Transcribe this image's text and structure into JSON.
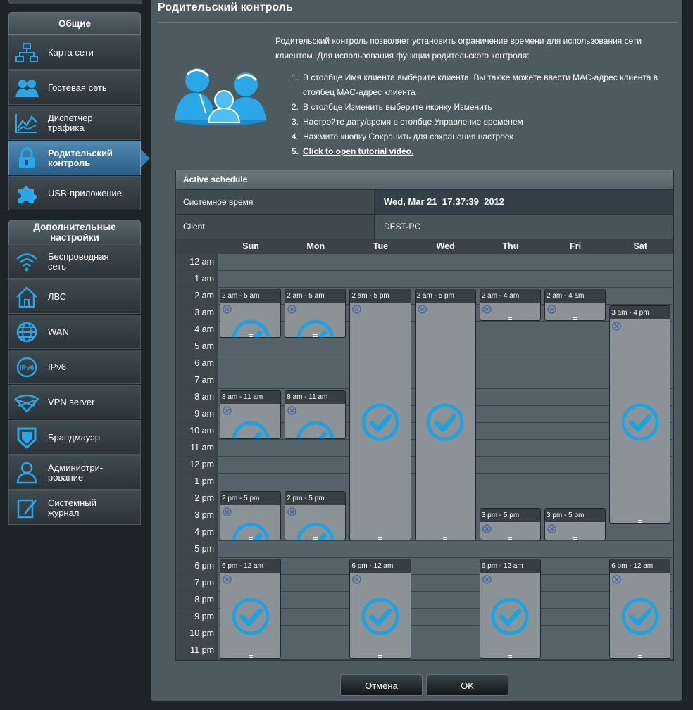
{
  "sidebar": {
    "general_title": "Общие",
    "general_items": [
      {
        "label": "Карта сети",
        "icon": "network-map-icon"
      },
      {
        "label": "Гостевая сеть",
        "icon": "guest-network-icon"
      },
      {
        "label": "Диспетчер\nтрафика",
        "icon": "traffic-manager-icon"
      },
      {
        "label": "Родительский\nконтроль",
        "icon": "lock-icon",
        "active": true
      },
      {
        "label": "USB-приложение",
        "icon": "puzzle-icon"
      }
    ],
    "advanced_title": "Дополнительные\nнастройки",
    "advanced_items": [
      {
        "label": "Беспроводная\nсеть",
        "icon": "wifi-icon"
      },
      {
        "label": "ЛВС",
        "icon": "home-icon"
      },
      {
        "label": "WAN",
        "icon": "globe-icon"
      },
      {
        "label": "IPv6",
        "icon": "ipv6-icon"
      },
      {
        "label": "VPN server",
        "icon": "vpn-icon"
      },
      {
        "label": "Брандмауэр",
        "icon": "shield-icon"
      },
      {
        "label": "Администри-\nрование",
        "icon": "user-icon"
      },
      {
        "label": "Системный\nжурнал",
        "icon": "edit-log-icon"
      }
    ]
  },
  "page": {
    "title": "Родительский контроль",
    "description": "Родительский контроль позволяет установить ограничение времени для использования сети клиентом. Для использования функции родительского контроля:",
    "steps": [
      {
        "num": "1.",
        "text": "В столбце Имя клиента выберите клиента. Вы также можете ввести MAC-адрес клиента в столбец MAC-адрес клиента"
      },
      {
        "num": "2.",
        "text": "В столбце Изменить выберите иконку Изменить"
      },
      {
        "num": "3.",
        "text": "Настройте дату/время в столбце Управление временем"
      },
      {
        "num": "4.",
        "text": "Нажмите кнопку Сохранить для сохранения настроек"
      },
      {
        "num": "5.",
        "text": "Click to open tutorial video.",
        "link": true
      }
    ]
  },
  "schedule": {
    "header": "Active schedule",
    "system_time_label": "Системное время",
    "system_time_value": "Wed, Mar 21  17:37:39  2012",
    "client_label": "Client",
    "client_value": "DEST-PC",
    "days": [
      "Sun",
      "Mon",
      "Tue",
      "Wed",
      "Thu",
      "Fri",
      "Sat"
    ],
    "hours": [
      "12 am",
      "1 am",
      "2 am",
      "3 am",
      "4 am",
      "5 am",
      "6 am",
      "7 am",
      "8 am",
      "9 am",
      "10 am",
      "11 am",
      "12 pm",
      "1 pm",
      "2 pm",
      "3 pm",
      "4 pm",
      "5 pm",
      "6 pm",
      "7 pm",
      "8 pm",
      "9 pm",
      "10 pm",
      "11 pm"
    ],
    "blocks": [
      {
        "day": 0,
        "start": 2,
        "end": 5,
        "label": "2 am - 5 am"
      },
      {
        "day": 1,
        "start": 2,
        "end": 5,
        "label": "2 am - 5 am"
      },
      {
        "day": 2,
        "start": 2,
        "end": 17,
        "label": "2 am - 5 pm"
      },
      {
        "day": 3,
        "start": 2,
        "end": 17,
        "label": "2 am - 5 pm"
      },
      {
        "day": 4,
        "start": 2,
        "end": 4,
        "label": "2 am - 4 am"
      },
      {
        "day": 5,
        "start": 2,
        "end": 4,
        "label": "2 am - 4 am"
      },
      {
        "day": 6,
        "start": 3,
        "end": 16,
        "label": "3 am - 4 pm"
      },
      {
        "day": 0,
        "start": 8,
        "end": 11,
        "label": "8 am - 11 am"
      },
      {
        "day": 1,
        "start": 8,
        "end": 11,
        "label": "8 am - 11 am"
      },
      {
        "day": 0,
        "start": 14,
        "end": 17,
        "label": "2 pm - 5 pm"
      },
      {
        "day": 1,
        "start": 14,
        "end": 17,
        "label": "2 pm - 5 pm"
      },
      {
        "day": 4,
        "start": 15,
        "end": 17,
        "label": "3 pm - 5 pm"
      },
      {
        "day": 5,
        "start": 15,
        "end": 17,
        "label": "3 pm - 5 pm"
      },
      {
        "day": 0,
        "start": 18,
        "end": 24,
        "label": "6 pm - 12 am"
      },
      {
        "day": 2,
        "start": 18,
        "end": 24,
        "label": "6 pm - 12 am"
      },
      {
        "day": 4,
        "start": 18,
        "end": 24,
        "label": "6 pm - 12 am"
      },
      {
        "day": 6,
        "start": 18,
        "end": 24,
        "label": "6 pm - 12 am"
      }
    ]
  },
  "buttons": {
    "cancel": "Отмена",
    "ok": "OK"
  },
  "colors": {
    "accent_blue": "#1fa2e0",
    "active_menu": "#3d7aa3"
  }
}
